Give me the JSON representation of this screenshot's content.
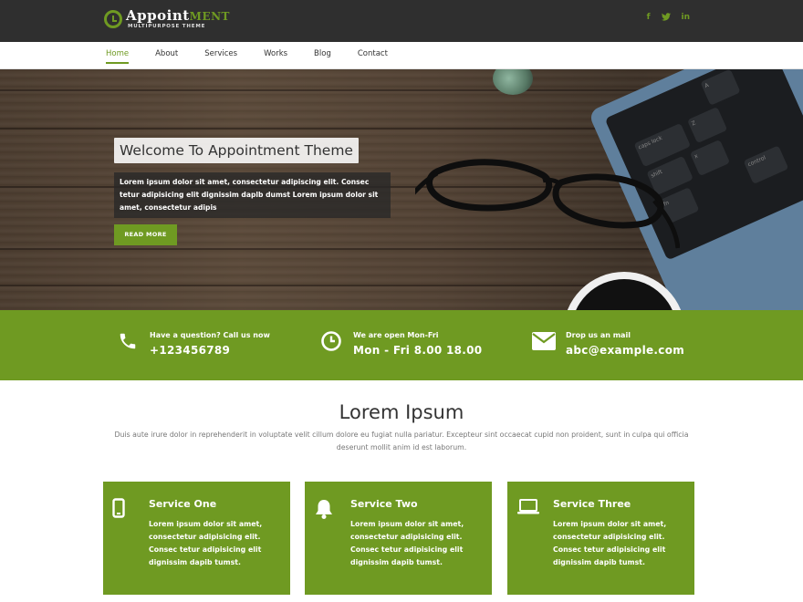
{
  "header": {
    "logo_title_main": "Appoint",
    "logo_title_accent": "ment",
    "logo_subtitle": "MULTIPURPOSE THEME",
    "social": [
      {
        "icon": "facebook-icon",
        "glyph": "f"
      },
      {
        "icon": "twitter-icon",
        "glyph": "t"
      },
      {
        "icon": "linkedin-icon",
        "glyph": "in"
      }
    ]
  },
  "nav": {
    "items": [
      {
        "label": "Home",
        "active": true
      },
      {
        "label": "About",
        "active": false
      },
      {
        "label": "Services",
        "active": false
      },
      {
        "label": "Works",
        "active": false
      },
      {
        "label": "Blog",
        "active": false
      },
      {
        "label": "Contact",
        "active": false
      }
    ]
  },
  "hero": {
    "title": "Welcome To Appointment Theme",
    "text": "Lorem ipsum dolor sit amet, consectetur adipiscing elit. Consec tetur adipisicing elit dignissim daplb dumst Lorem ipsum dolor sit amet, consectetur adipis",
    "button_label": "READ MORE",
    "keyboard_keys": [
      "A",
      "caps lock",
      "Z",
      "shift",
      "control",
      "fn",
      "x"
    ]
  },
  "info": [
    {
      "icon": "phone-icon",
      "label": "Have a question? Call us now",
      "value": "+123456789"
    },
    {
      "icon": "clock-icon",
      "label": "We are open Mon-Fri",
      "value": "Mon - Fri 8.00 18.00"
    },
    {
      "icon": "envelope-icon",
      "label": "Drop us an mail",
      "value": "abc@example.com"
    }
  ],
  "services_section": {
    "title": "Lorem Ipsum",
    "subtitle": "Duis aute irure dolor in reprehenderit in voluptate velit cillum dolore eu fugiat nulla pariatur. Excepteur sint occaecat cupid non proident, sunt in culpa qui officia deserunt mollit anim id est laborum.",
    "cards": [
      {
        "icon": "mobile-icon",
        "title": "Service One",
        "text": "Lorem ipsum dolor sit amet, consectetur adipisicing elit. Consec tetur adipisicing elit dignissim dapib tumst."
      },
      {
        "icon": "bell-icon",
        "title": "Service Two",
        "text": "Lorem ipsum dolor sit amet, consectetur adipisicing elit. Consec tetur adipisicing elit dignissim dapib tumst."
      },
      {
        "icon": "laptop-icon",
        "title": "Service Three",
        "text": "Lorem ipsum dolor sit amet, consectetur adipisicing elit. Consec tetur adipisicing elit dignissim dapib tumst."
      }
    ]
  },
  "colors": {
    "accent": "#6f9a22",
    "topbar": "#2f2f2f"
  }
}
